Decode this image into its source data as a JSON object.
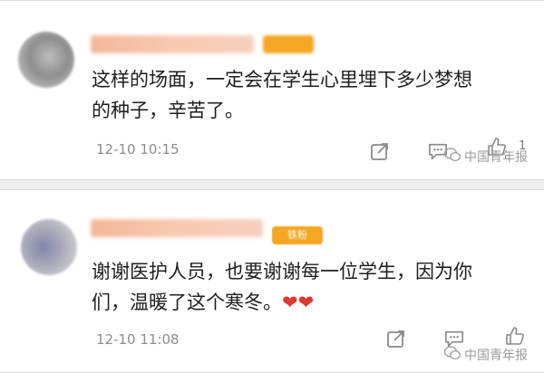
{
  "comments": [
    {
      "text": "这样的场面，一定会在学生心里埋下多少梦想的种子，辛苦了。",
      "time": "12-10 10:15",
      "likes": "1"
    },
    {
      "text": "谢谢医护人员，也要谢谢每一位学生，因为你们，温暖了这个寒冬。",
      "hearts": "❤❤",
      "time": "12-10 11:08",
      "badge": "铁粉"
    }
  ],
  "watermark": "中国青年报",
  "icons": [
    "share-icon",
    "comment-icon",
    "like-icon"
  ],
  "colors": {
    "badge": "#f5a623",
    "heart": "#e0372f",
    "timestamp": "#8d8d8d"
  }
}
